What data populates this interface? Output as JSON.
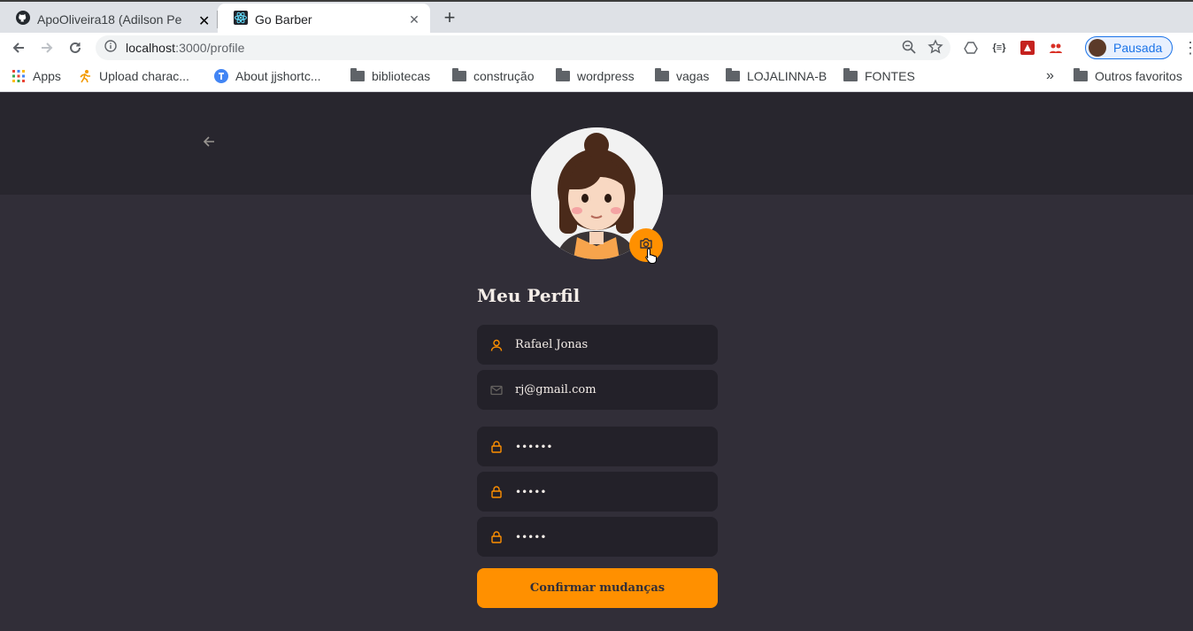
{
  "browser": {
    "tabs": [
      {
        "title": "ApoOliveira18 (Adilson Pe",
        "icon": "github-icon",
        "active": false
      },
      {
        "title": "Go Barber",
        "icon": "react-icon",
        "active": true
      }
    ],
    "new_tab_label": "+",
    "url": {
      "host": "localhost",
      "rest": ":3000/profile"
    },
    "profile_label": "Pausada",
    "bookmarks": [
      {
        "label": "Apps",
        "icon": "apps-grid-icon"
      },
      {
        "label": "Upload charac...",
        "icon": "runner-icon"
      },
      {
        "label": "About jjshortc...",
        "icon": "shortcut-icon"
      },
      {
        "label": "bibliotecas",
        "icon": "folder-icon"
      },
      {
        "label": "construção",
        "icon": "folder-icon"
      },
      {
        "label": "wordpress",
        "icon": "folder-icon"
      },
      {
        "label": "vagas",
        "icon": "folder-icon"
      },
      {
        "label": "LOJALINNA-B",
        "icon": "folder-icon"
      },
      {
        "label": "FONTES",
        "icon": "folder-icon"
      }
    ],
    "overflow_label": "»",
    "other_bookmarks": "Outros favoritos"
  },
  "profile_page": {
    "title": "Meu Perfil",
    "fields": {
      "name": "Rafael Jonas",
      "email": "rj@gmail.com",
      "old_password": "••••••",
      "new_password": "•••••",
      "confirm_password": "•••••"
    },
    "submit_label": "Confirmar mudanças"
  },
  "colors": {
    "accent": "#ff9000",
    "background": "#312e38",
    "header": "#28262e",
    "input": "#232129",
    "text": "#f4ede8"
  }
}
